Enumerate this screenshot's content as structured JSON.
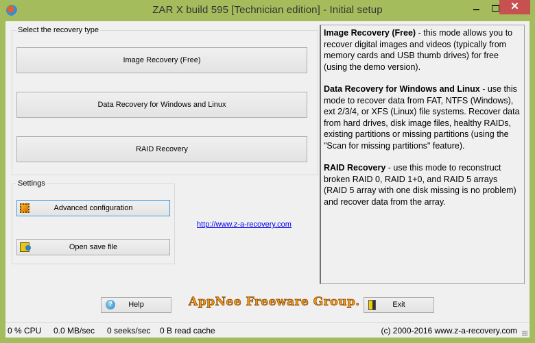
{
  "window": {
    "title": "ZAR X build 595 [Technician edition] - Initial setup",
    "app_icon": "zar-app-icon",
    "controls": {
      "minimize": "minimize",
      "maximize": "maximize",
      "close": "✕"
    }
  },
  "recovery_group": {
    "label": "Select the recovery type",
    "buttons": [
      {
        "label": "Image Recovery (Free)"
      },
      {
        "label": "Data Recovery for Windows and Linux"
      },
      {
        "label": "RAID Recovery"
      }
    ]
  },
  "settings_group": {
    "label": "Settings",
    "buttons": [
      {
        "label": "Advanced configuration",
        "icon": "chip-icon"
      },
      {
        "label": "Open save file",
        "icon": "open-folder-icon"
      }
    ]
  },
  "link": {
    "text": "http://www.z-a-recovery.com"
  },
  "description": {
    "sections": [
      {
        "title": "Image Recovery (Free)",
        "text": " - this mode allows you to recover digital images and videos (typically from memory cards and USB thumb drives) for free (using the demo version)."
      },
      {
        "title": "Data Recovery for Windows and Linux",
        "text": " - use this mode to recover data from FAT, NTFS (Windows), ext 2/3/4, or XFS (Linux) file systems. Recover data from hard drives, disk image files, healthy RAIDs, existing partitions or missing partitions (using the \"Scan for missing partitions\" feature)."
      },
      {
        "title": "RAID Recovery",
        "text": " - use this mode to reconstruct broken RAID 0, RAID 1+0, and RAID 5 arrays (RAID 5 array with one disk missing is no problem) and recover data from the array."
      }
    ]
  },
  "bottom": {
    "help_label": "Help",
    "exit_label": "Exit",
    "watermark": "AppNee Freeware Group."
  },
  "status": {
    "cpu": "0 % CPU",
    "throughput": "0.0 MB/sec",
    "seeks": "0 seeks/sec",
    "cache": "0 B read cache",
    "copyright": "(c) 2000-2016 www.z-a-recovery.com"
  },
  "colors": {
    "titlebar": "#a5bc5c",
    "close": "#c75050",
    "watermark": "#f39a1e",
    "link": "#0000ee"
  }
}
